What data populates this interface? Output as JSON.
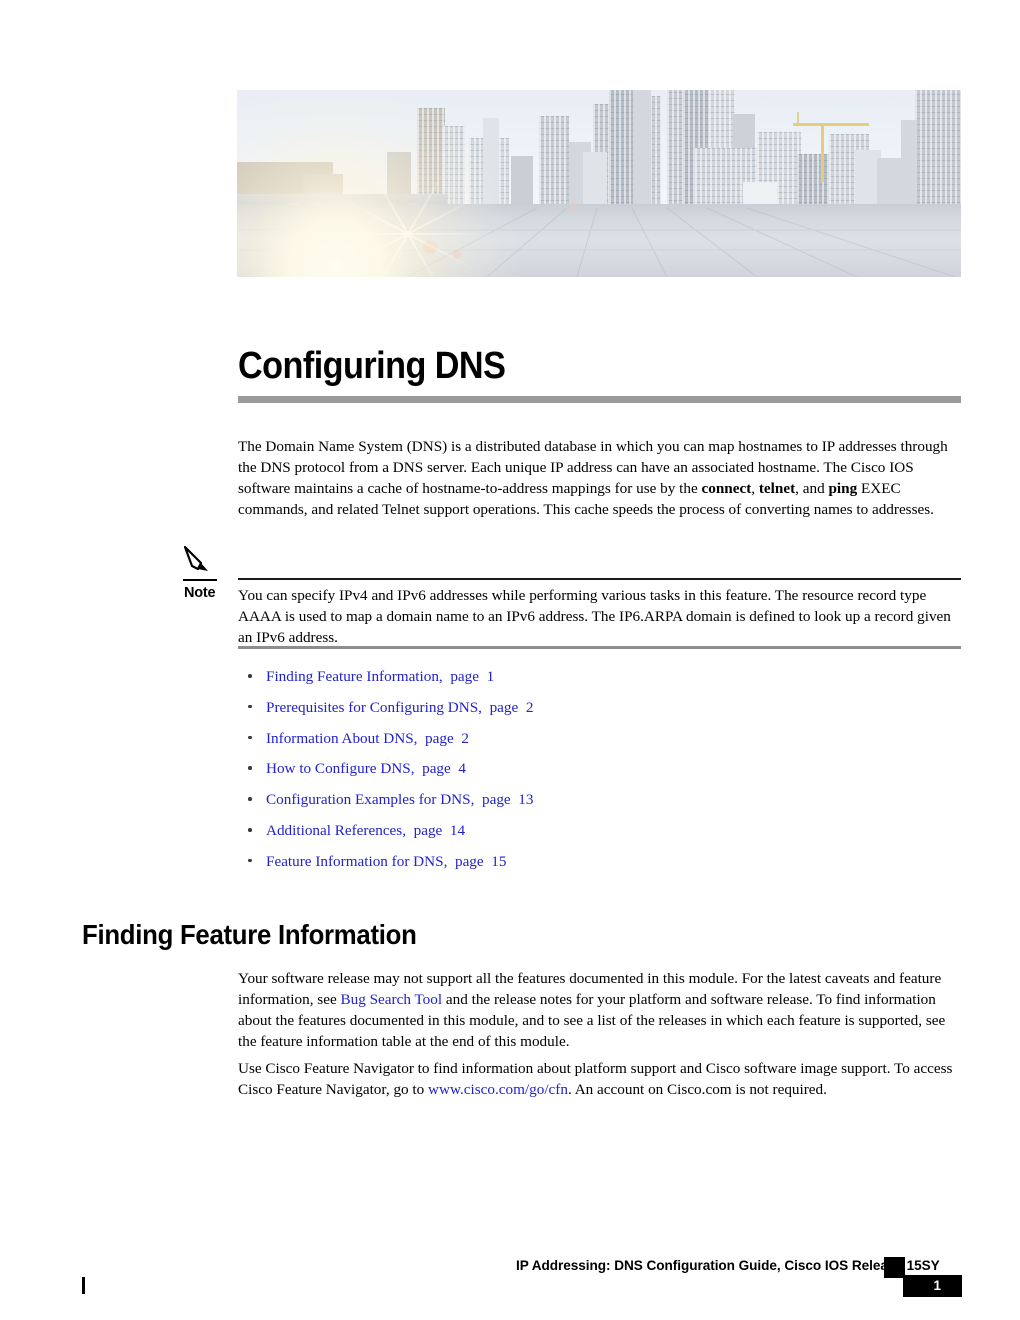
{
  "document": {
    "chapter_title": "Configuring DNS",
    "banner_alt": "city-skyline-photo"
  },
  "intro": {
    "text_parts": [
      {
        "t": "The Domain Name System (DNS) is a distributed database in which you can map hostnames to IP addresses through the DNS protocol from a DNS server. Each unique IP address can have an associated hostname. The Cisco IOS software maintains a cache of hostname-to-address mappings for use by the ",
        "style": "normal"
      },
      {
        "t": "connect",
        "style": "bold"
      },
      {
        "t": ", ",
        "style": "normal"
      },
      {
        "t": "telnet",
        "style": "bold"
      },
      {
        "t": ", and ",
        "style": "normal"
      },
      {
        "t": "ping",
        "style": "bold"
      },
      {
        "t": " EXEC commands, and related Telnet support operations. This cache speeds the process of converting names to addresses.",
        "style": "normal"
      }
    ]
  },
  "note": {
    "label": "Note",
    "icon": "pencil-icon",
    "body": "You can specify IPv4 and IPv6 addresses while performing various tasks in this feature. The resource record type AAAA is used to map a domain name to an IPv6 address. The IP6.ARPA domain is defined to look up a record given an IPv6 address."
  },
  "toc": {
    "items": [
      {
        "label": "Finding Feature Information,",
        "page_label": "page",
        "page": "1"
      },
      {
        "label": "Prerequisites for Configuring DNS,",
        "page_label": "page",
        "page": "2"
      },
      {
        "label": "Information About DNS,",
        "page_label": "page",
        "page": "2"
      },
      {
        "label": "How to Configure DNS,",
        "page_label": "page",
        "page": "4"
      },
      {
        "label": "Configuration Examples for DNS,",
        "page_label": "page",
        "page": "13"
      },
      {
        "label": "Additional References,",
        "page_label": "page",
        "page": "14"
      },
      {
        "label": "Feature Information for DNS,",
        "page_label": "page",
        "page": "15"
      }
    ]
  },
  "section": {
    "heading": "Finding Feature Information",
    "para1_before_link": "Your software release may not support all the features documented in this module. For the latest caveats and feature information, see ",
    "para1_link": "Bug Search Tool",
    "para1_after_link": " and the release notes for your platform and software release. To find information about the features documented in this module, and to see a list of the releases in which each feature is supported, see the feature information table at the end of this module.",
    "para2_before_link": "Use Cisco Feature Navigator to find information about platform support and Cisco software image support. To access Cisco Feature Navigator, go to ",
    "para2_link": "www.cisco.com/go/cfn",
    "para2_after_link": ". An account on Cisco.com is not required."
  },
  "footer": {
    "guide_title": "IP Addressing: DNS Configuration Guide, Cisco IOS Release 15SY",
    "page_number": "1"
  },
  "colors": {
    "link": "#2222cc",
    "title_rule": "#9b9b9b",
    "note_rule_top": "#1a1a1a",
    "note_rule_bottom": "#8d8d8d",
    "footer_box": "#000000",
    "text": "#000000"
  }
}
